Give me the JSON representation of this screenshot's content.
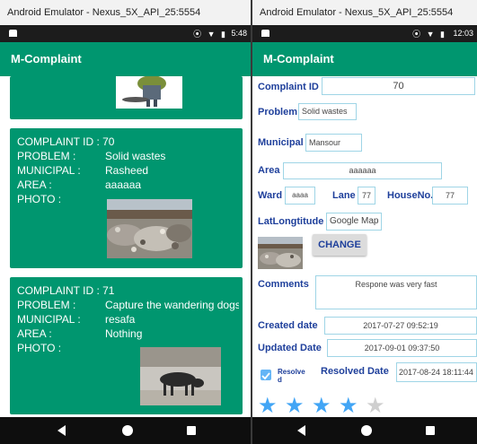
{
  "left_window": {
    "title": "Android Emulator - Nexus_5X_API_25:5554",
    "status_icons": "⦿ ▼ ▮",
    "time": "5:48",
    "app_title": "M-Complaint",
    "complaints": [
      {
        "id_label": "COMPLAINT ID : 70",
        "problem_key": "PROBLEM :",
        "problem_value": "Solid wastes",
        "municipal_key": "MUNICIPAL :",
        "municipal_value": "Rasheed",
        "area_key": "AREA :",
        "area_value": "aaaaaa",
        "photo_key": "PHOTO :"
      },
      {
        "id_label": "COMPLAINT ID : 71",
        "problem_key": "PROBLEM :",
        "problem_value": "Capture the wandering dogs",
        "municipal_key": "MUNICIPAL :",
        "municipal_value": "resafa",
        "area_key": "AREA :",
        "area_value": "Nothing",
        "photo_key": "PHOTO :"
      }
    ]
  },
  "right_window": {
    "title": "Android Emulator - Nexus_5X_API_25:5554",
    "status_icons": "⦿ ▼ ▮",
    "time": "12:03",
    "app_title": "M-Complaint",
    "form": {
      "complaint_id_label": "Complaint ID",
      "complaint_id_value": "70",
      "problem_label": "Problem",
      "problem_value": "Solid wastes",
      "municipal_label": "Municipal",
      "municipal_value": "Mansour",
      "area_label": "Area",
      "area_value": "aaaaaa",
      "ward_label": "Ward",
      "ward_value": "aaaa",
      "lane_label": "Lane",
      "lane_value": "77",
      "house_label": "HouseNo.",
      "house_value": "77",
      "latlong_label": "LatLongtitude",
      "latlong_value": "Google Map",
      "change_button": "CHANGE",
      "comments_label": "Comments",
      "comments_value": "Respone was very fast",
      "created_label": "Created date",
      "created_value": "2017-07-27 09:52:19",
      "updated_label": "Updated Date",
      "updated_value": "2017-09-01 09:37:50",
      "resolved_check_label": "Resolve d",
      "resolved_checked": true,
      "resolved_date_label": "Resolved Date",
      "resolved_date_value": "2017-08-24 18:11:44",
      "rating": 4,
      "rating_max": 5
    }
  },
  "colors": {
    "app_bar": "#00966f",
    "card": "#00966f",
    "label_blue": "#1e3f9b",
    "field_border": "#9fd5e6",
    "star_filled": "#42a5f5",
    "star_empty": "#cfcfcf"
  },
  "icons": {
    "nav_back": "back-triangle-icon",
    "nav_home": "home-circle-icon",
    "nav_recent": "recent-square-icon"
  }
}
